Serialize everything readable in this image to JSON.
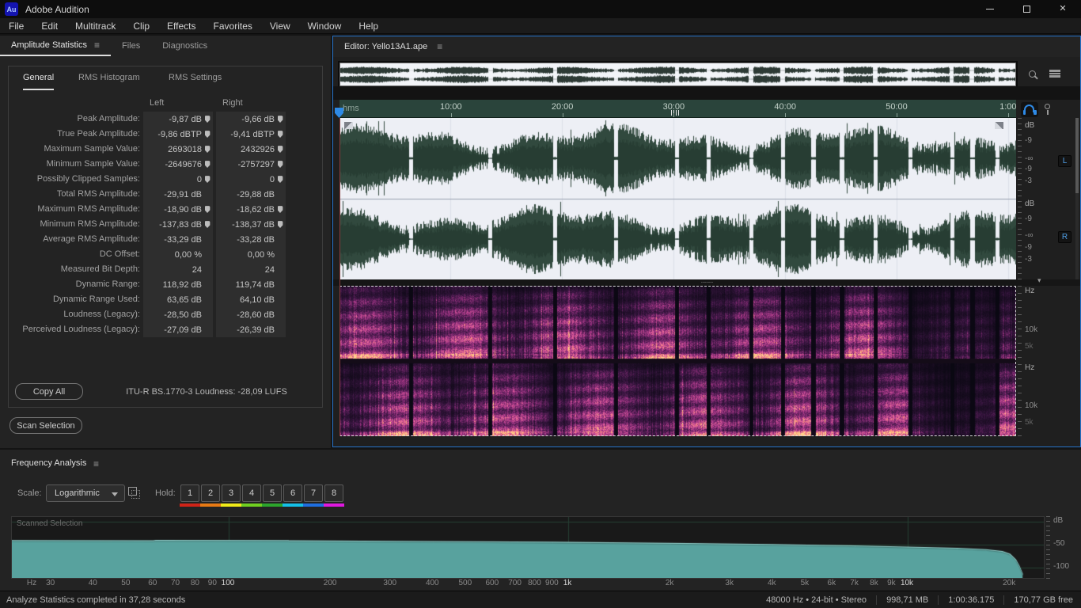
{
  "app": {
    "title": "Adobe Audition",
    "logo_text": "Au"
  },
  "menu": [
    "File",
    "Edit",
    "Multitrack",
    "Clip",
    "Effects",
    "Favorites",
    "View",
    "Window",
    "Help"
  ],
  "stats_panel": {
    "tabs": [
      "Amplitude Statistics",
      "Files",
      "Diagnostics"
    ],
    "subtabs": [
      "General",
      "RMS Histogram",
      "RMS Settings"
    ],
    "col_headers": [
      "Left",
      "Right"
    ],
    "rows": [
      {
        "label": "Peak Amplitude:",
        "left": "-9,87 dB",
        "right": "-9,66 dB",
        "marker": true
      },
      {
        "label": "True Peak Amplitude:",
        "left": "-9,86 dBTP",
        "right": "-9,41 dBTP",
        "marker": true
      },
      {
        "label": "Maximum Sample Value:",
        "left": "2693018",
        "right": "2432926",
        "marker": true
      },
      {
        "label": "Minimum Sample Value:",
        "left": "-2649676",
        "right": "-2757297",
        "marker": true
      },
      {
        "label": "Possibly Clipped Samples:",
        "left": "0",
        "right": "0",
        "marker": true
      },
      {
        "label": "Total RMS Amplitude:",
        "left": "-29,91 dB",
        "right": "-29,88 dB",
        "marker": false
      },
      {
        "label": "Maximum RMS Amplitude:",
        "left": "-18,90 dB",
        "right": "-18,62 dB",
        "marker": true
      },
      {
        "label": "Minimum RMS Amplitude:",
        "left": "-137,83 dB",
        "right": "-138,37 dB",
        "marker": true
      },
      {
        "label": "Average RMS Amplitude:",
        "left": "-33,29 dB",
        "right": "-33,28 dB",
        "marker": false
      },
      {
        "label": "DC Offset:",
        "left": "0,00 %",
        "right": "0,00 %",
        "marker": false
      },
      {
        "label": "Measured Bit Depth:",
        "left": "24",
        "right": "24",
        "marker": false
      },
      {
        "label": "Dynamic Range:",
        "left": "118,92 dB",
        "right": "119,74 dB",
        "marker": false
      },
      {
        "label": "Dynamic Range Used:",
        "left": "63,65 dB",
        "right": "64,10 dB",
        "marker": false
      },
      {
        "label": "Loudness (Legacy):",
        "left": "-28,50 dB",
        "right": "-28,60 dB",
        "marker": false
      },
      {
        "label": "Perceived Loudness (Legacy):",
        "left": "-27,09 dB",
        "right": "-26,39 dB",
        "marker": false
      }
    ],
    "copy_all": "Copy All",
    "loudness": "ITU-R BS.1770-3 Loudness:  -28,09 LUFS",
    "scan_selection": "Scan Selection"
  },
  "editor": {
    "title": "Editor: Yello13A1.ape",
    "timeline_unit": "hms",
    "timeline_ticks": [
      "10:00",
      "20:00",
      "30:00",
      "40:00",
      "50:00",
      "1:00"
    ],
    "amplitude_ruler": [
      "dB",
      "-9",
      "-∞",
      "-9",
      "-3"
    ],
    "frequency_ruler": [
      "Hz",
      "10k",
      "5k"
    ],
    "channels": [
      "L",
      "R"
    ]
  },
  "frequency_analysis": {
    "title": "Frequency Analysis",
    "scale_label": "Scale:",
    "scale_value": "Logarithmic",
    "hold_label": "Hold:",
    "holds": [
      {
        "n": "1",
        "color": "#d02418"
      },
      {
        "n": "2",
        "color": "#e87a14"
      },
      {
        "n": "3",
        "color": "#f0ea18"
      },
      {
        "n": "4",
        "color": "#70d020"
      },
      {
        "n": "5",
        "color": "#2ca52c"
      },
      {
        "n": "6",
        "color": "#14c0e8"
      },
      {
        "n": "7",
        "color": "#1e6ee0"
      },
      {
        "n": "8",
        "color": "#e018e0"
      }
    ],
    "plot_label": "Scanned Selection",
    "x_unit": "Hz",
    "x_ticks": [
      {
        "f": 30,
        "label": "30"
      },
      {
        "f": 40,
        "label": "40"
      },
      {
        "f": 50,
        "label": "50"
      },
      {
        "f": 60,
        "label": "60"
      },
      {
        "f": 70,
        "label": "70"
      },
      {
        "f": 80,
        "label": "80"
      },
      {
        "f": 90,
        "label": "90"
      },
      {
        "f": 100,
        "label": "100",
        "strong": true
      },
      {
        "f": 200,
        "label": "200"
      },
      {
        "f": 300,
        "label": "300"
      },
      {
        "f": 400,
        "label": "400"
      },
      {
        "f": 500,
        "label": "500"
      },
      {
        "f": 600,
        "label": "600"
      },
      {
        "f": 700,
        "label": "700"
      },
      {
        "f": 800,
        "label": "800"
      },
      {
        "f": 900,
        "label": "900"
      },
      {
        "f": 1000,
        "label": "1k",
        "strong": true
      },
      {
        "f": 2000,
        "label": "2k"
      },
      {
        "f": 3000,
        "label": "3k"
      },
      {
        "f": 4000,
        "label": "4k"
      },
      {
        "f": 5000,
        "label": "5k"
      },
      {
        "f": 6000,
        "label": "6k"
      },
      {
        "f": 7000,
        "label": "7k"
      },
      {
        "f": 8000,
        "label": "8k"
      },
      {
        "f": 9000,
        "label": "9k"
      },
      {
        "f": 10000,
        "label": "10k",
        "strong": true
      },
      {
        "f": 20000,
        "label": "20k"
      }
    ],
    "y_ticks": [
      "dB",
      "-50",
      "-100"
    ],
    "curve_db_by_freq": [
      [
        23,
        -41.5
      ],
      [
        60,
        -41.8
      ],
      [
        61,
        -41.1
      ],
      [
        150,
        -41.5
      ],
      [
        151,
        -42
      ],
      [
        400,
        -43.4
      ],
      [
        900,
        -45
      ],
      [
        2000,
        -47.4
      ],
      [
        4000,
        -50
      ],
      [
        7000,
        -53
      ],
      [
        10000,
        -55.5
      ],
      [
        14000,
        -58
      ],
      [
        17000,
        -61
      ],
      [
        19000,
        -65
      ],
      [
        20000,
        -71
      ],
      [
        20800,
        -83
      ],
      [
        21300,
        -97
      ],
      [
        21800,
        -115
      ]
    ]
  },
  "status": {
    "message": "Analyze Statistics completed in 37,28 seconds",
    "sample_info": "48000 Hz • 24-bit • Stereo",
    "file_size": "998,71 MB",
    "duration": "1:00:36.175",
    "free_space": "170,77 GB free"
  },
  "colors": {
    "accent_blue": "#2e8ae6",
    "waveform_green": "#31493e",
    "timeline_green": "#2a443b",
    "freq_fill_teal": "#58a29e",
    "panel_bg": "#232323"
  }
}
